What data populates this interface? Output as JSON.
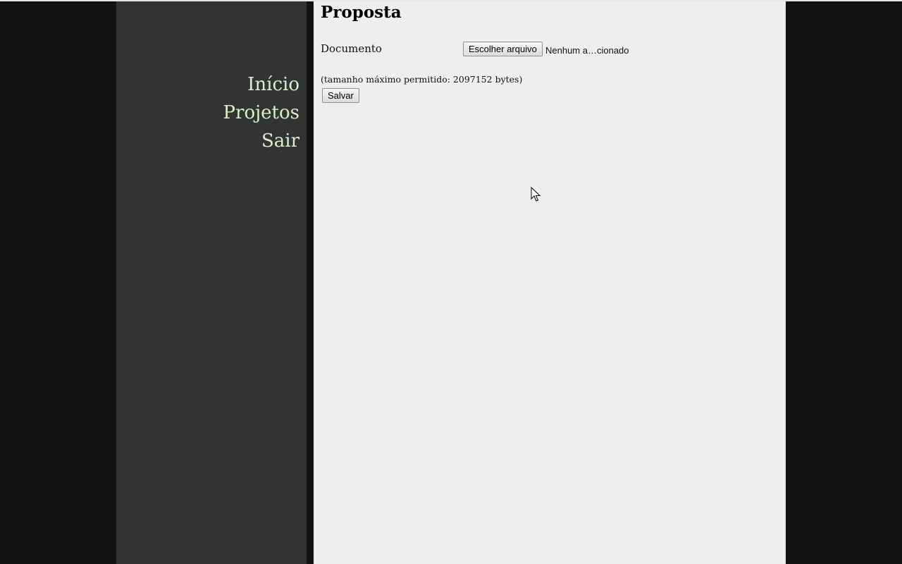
{
  "nav": {
    "items": [
      {
        "label": "Início"
      },
      {
        "label": "Projetos"
      },
      {
        "label": "Sair"
      }
    ]
  },
  "main": {
    "title": "Proposta",
    "document_label": "Documento",
    "file_button_label": "Escolher arquivo",
    "file_status": "Nenhum a…cionado",
    "size_note": "(tamanho máximo permitido: 2097152 bytes)",
    "save_label": "Salvar"
  },
  "colors": {
    "background": "#121212",
    "sidebar": "#333333",
    "main_panel": "#eeeeee",
    "nav_link": "#d9f0c8"
  },
  "icons": {
    "cursor": "mouse-pointer-icon"
  }
}
